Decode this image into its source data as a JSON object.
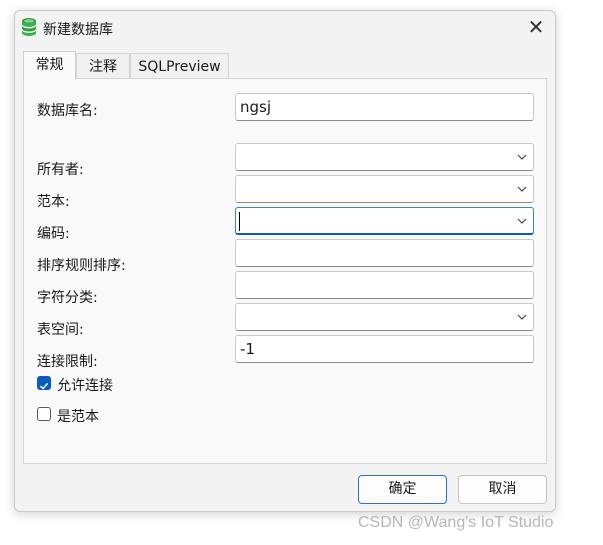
{
  "window": {
    "title": "新建数据库",
    "app_icon": "database-icon",
    "close_icon": "close-icon",
    "close_glyph": "✕"
  },
  "tabs": [
    {
      "label": "常规",
      "active": true
    },
    {
      "label": "注释",
      "active": false
    },
    {
      "label": "SQLPreview",
      "active": false
    }
  ],
  "form": {
    "database_name": {
      "label": "数据库名:",
      "value": "ngsj"
    },
    "owner": {
      "label": "所有者:",
      "value": ""
    },
    "template": {
      "label": "范本:",
      "value": ""
    },
    "encoding": {
      "label": "编码:",
      "value": ""
    },
    "collation": {
      "label": "排序规则排序:",
      "value": ""
    },
    "ctype": {
      "label": "字符分类:",
      "value": ""
    },
    "tablespace": {
      "label": "表空间:",
      "value": ""
    },
    "connection_limit": {
      "label": "连接限制:",
      "value": "-1"
    },
    "allow_connections": {
      "label": "允许连接",
      "checked": true
    },
    "is_template": {
      "label": "是范本",
      "checked": false
    }
  },
  "buttons": {
    "ok": "确定",
    "cancel": "取消"
  },
  "watermark": "CSDN @Wang's IoT Studio",
  "colors": {
    "accent": "#0b5cc1",
    "db_icon": "#2e9e3e"
  }
}
